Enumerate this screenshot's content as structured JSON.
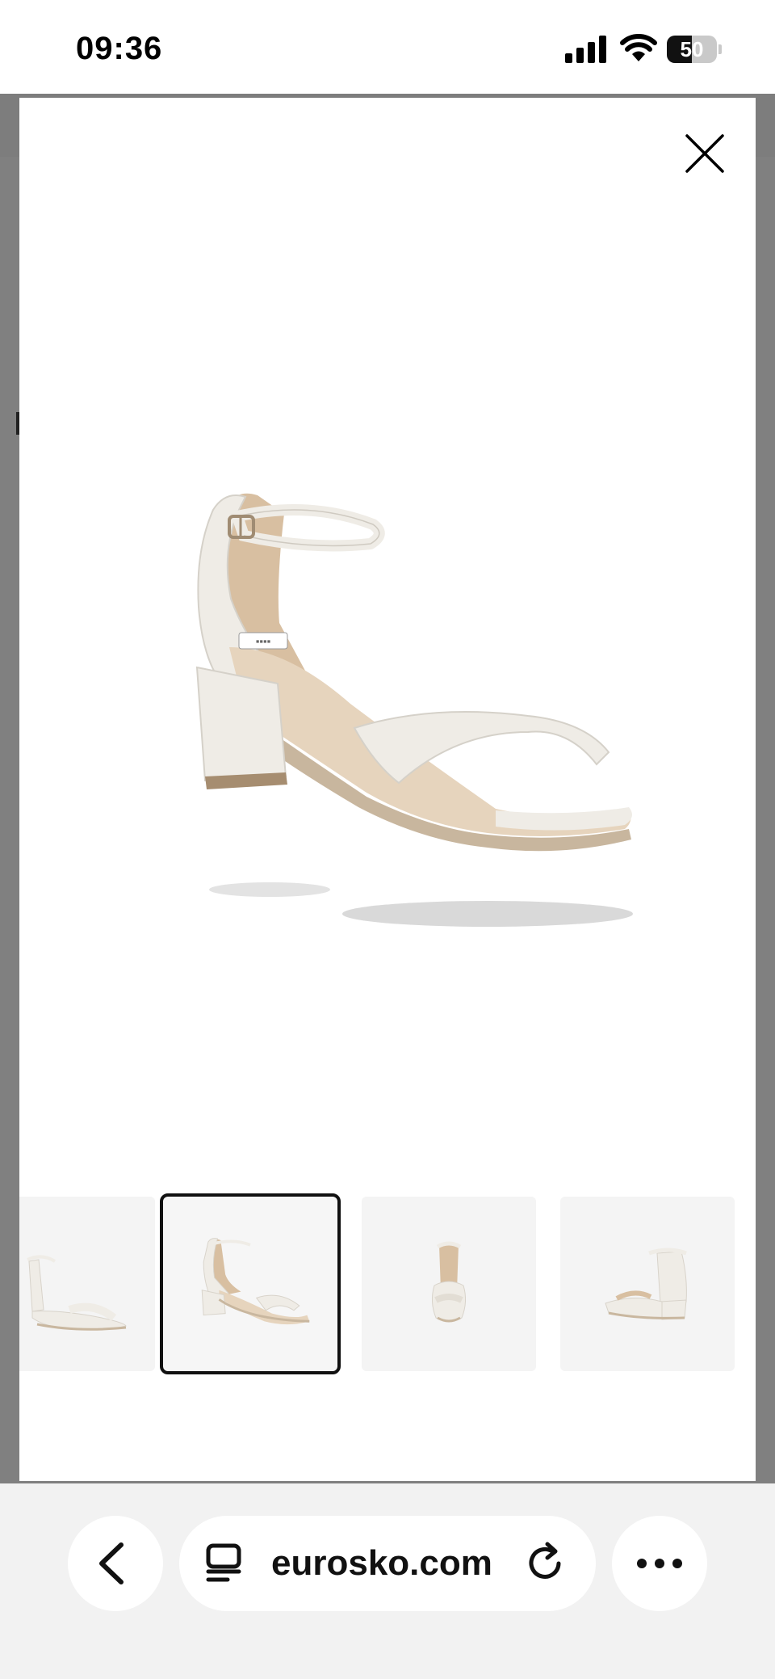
{
  "status_bar": {
    "time": "09:36",
    "battery_level": "50",
    "battery_fraction": 0.5
  },
  "gallery": {
    "close_icon": "close-icon",
    "main_image": "white block heel ankle-strap sandal, three-quarter view",
    "selected_index": 1,
    "thumbnails": [
      {
        "view": "side view",
        "icon": "sandal-side-image"
      },
      {
        "view": "three-quarter view",
        "icon": "sandal-angle-image"
      },
      {
        "view": "front view",
        "icon": "sandal-front-image"
      },
      {
        "view": "back view",
        "icon": "sandal-back-image"
      }
    ]
  },
  "browser": {
    "back_icon": "chevron-left-icon",
    "tabs_icon": "tab-overview-icon",
    "url": "eurosko.com",
    "reload_icon": "reload-icon",
    "more_icon": "more-icon"
  },
  "colors": {
    "backdrop": "#808080",
    "selected_border": "#111111",
    "sandal_white": "#efece6",
    "sandal_lining": "#d8bfa1"
  }
}
